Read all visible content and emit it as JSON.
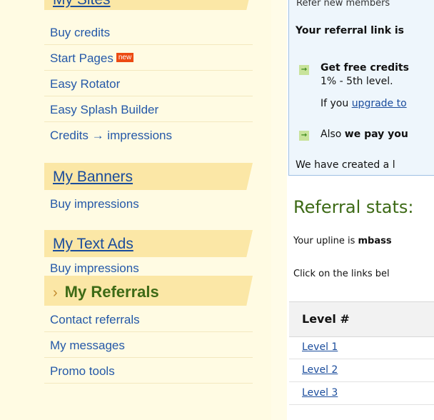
{
  "sidebar": {
    "top_section": {
      "label": "My Sites"
    },
    "sites_items": [
      {
        "label": "Buy credits"
      },
      {
        "label": "Start Pages",
        "badge": "new"
      },
      {
        "label": "Easy Rotator"
      },
      {
        "label": "Easy Splash Builder"
      },
      {
        "label": "Credits → impressions"
      }
    ],
    "banners": {
      "label": "My Banners",
      "items": [
        {
          "label": "Buy impressions"
        }
      ]
    },
    "textads": {
      "label": "My Text Ads",
      "items": [
        {
          "label": "Buy impressions"
        }
      ]
    },
    "referrals": {
      "label": "My Referrals",
      "chevron": "›",
      "items": [
        {
          "label": "Contact referrals"
        },
        {
          "label": "My messages"
        },
        {
          "label": "Promo tools"
        }
      ]
    }
  },
  "main": {
    "cut_top_text": "Refer new members",
    "referral_link_label": "Your referral link is",
    "bullet1_bold": "Get free credits",
    "bullet1_line2": "1% - 5th level.",
    "bullet1_line3_prefix": "If you ",
    "bullet1_line3_link": "upgrade to",
    "bullet2_prefix": "Also ",
    "bullet2_bold": "we pay you",
    "created_text": "We have created a l",
    "stats_title": "Referral stats:",
    "upline_prefix": "Your upline is ",
    "upline_name": "mbass",
    "click_text": "Click on the links bel",
    "table": {
      "header": "Level #",
      "rows": [
        "Level 1",
        "Level 2",
        "Level 3"
      ]
    }
  }
}
